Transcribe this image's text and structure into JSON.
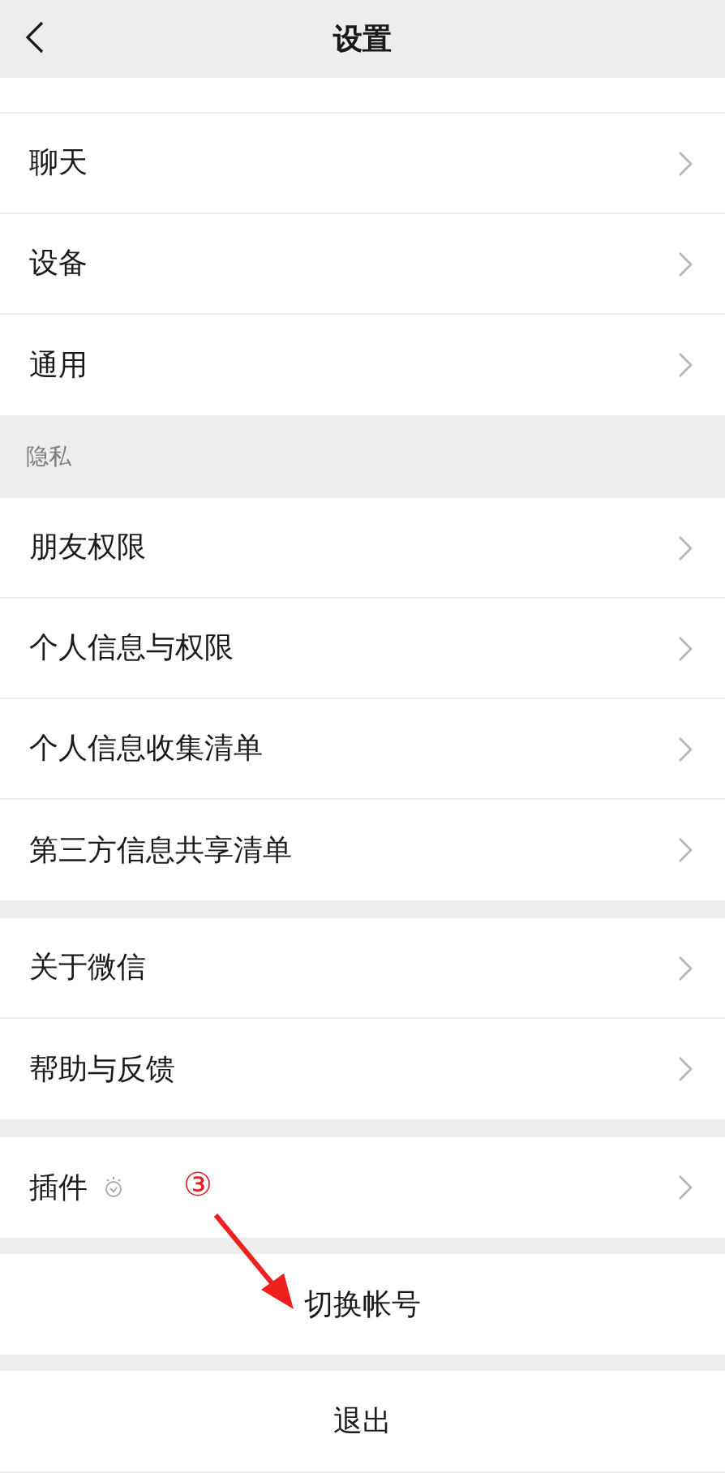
{
  "header": {
    "title": "设置"
  },
  "groups": [
    {
      "items": [
        {
          "label": "聊天"
        },
        {
          "label": "设备"
        },
        {
          "label": "通用"
        }
      ]
    },
    {
      "section_title": "隐私",
      "items": [
        {
          "label": "朋友权限"
        },
        {
          "label": "个人信息与权限"
        },
        {
          "label": "个人信息收集清单"
        },
        {
          "label": "第三方信息共享清单"
        }
      ]
    },
    {
      "items": [
        {
          "label": "关于微信"
        },
        {
          "label": "帮助与反馈"
        }
      ]
    },
    {
      "items": [
        {
          "label": "插件",
          "kind": "with-icon"
        }
      ]
    }
  ],
  "actions": [
    {
      "label": "切换帐号"
    },
    {
      "label": "退出"
    }
  ],
  "annotation": {
    "label": "③"
  }
}
